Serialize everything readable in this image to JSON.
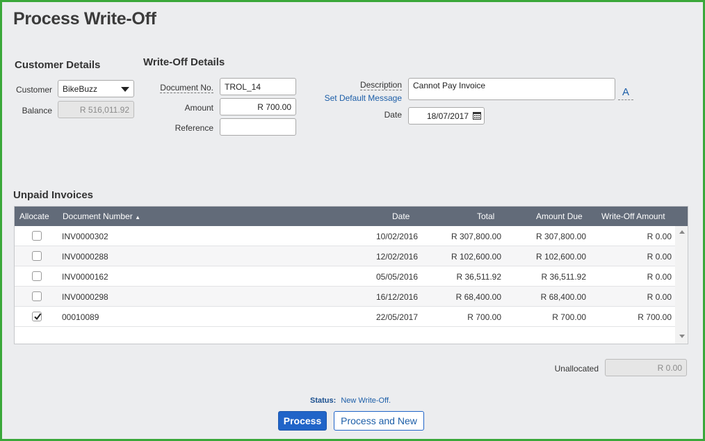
{
  "page": {
    "title": "Process Write-Off"
  },
  "customer_details": {
    "title": "Customer Details",
    "customer_label": "Customer",
    "customer_value": "BikeBuzz",
    "balance_label": "Balance",
    "balance_value": "R 516,011.92"
  },
  "writeoff_details": {
    "title": "Write-Off Details",
    "document_no_label": "Document No.",
    "document_no_value": "TROL_14",
    "amount_label": "Amount",
    "amount_value": "R 700.00",
    "reference_label": "Reference",
    "reference_value": "",
    "description_label": "Description",
    "description_value": "Cannot Pay Invoice",
    "set_default_message": "Set Default Message",
    "a_button": "A",
    "date_label": "Date",
    "date_value": "18/07/2017"
  },
  "unpaid_invoices": {
    "title": "Unpaid Invoices",
    "columns": {
      "allocate": "Allocate",
      "document_number": "Document Number",
      "date": "Date",
      "total": "Total",
      "amount_due": "Amount Due",
      "writeoff_amount": "Write-Off Amount"
    },
    "rows": [
      {
        "checked": false,
        "document_number": "INV0000302",
        "date": "10/02/2016",
        "total": "R 307,800.00",
        "amount_due": "R 307,800.00",
        "writeoff_amount": "R 0.00"
      },
      {
        "checked": false,
        "document_number": "INV0000288",
        "date": "12/02/2016",
        "total": "R 102,600.00",
        "amount_due": "R 102,600.00",
        "writeoff_amount": "R 0.00"
      },
      {
        "checked": false,
        "document_number": "INV0000162",
        "date": "05/05/2016",
        "total": "R 36,511.92",
        "amount_due": "R 36,511.92",
        "writeoff_amount": "R 0.00"
      },
      {
        "checked": false,
        "document_number": "INV0000298",
        "date": "16/12/2016",
        "total": "R 68,400.00",
        "amount_due": "R 68,400.00",
        "writeoff_amount": "R 0.00"
      },
      {
        "checked": true,
        "document_number": "00010089",
        "date": "22/05/2017",
        "total": "R 700.00",
        "amount_due": "R 700.00",
        "writeoff_amount": "R 700.00"
      }
    ]
  },
  "unallocated": {
    "label": "Unallocated",
    "value": "R 0.00"
  },
  "status": {
    "label": "Status:",
    "value": "New Write-Off."
  },
  "buttons": {
    "process": "Process",
    "process_and_new": "Process and New"
  },
  "colors": {
    "frame": "#3aa83a",
    "header": "#626b79",
    "primary": "#2064c8",
    "link": "#1c5ea8"
  }
}
